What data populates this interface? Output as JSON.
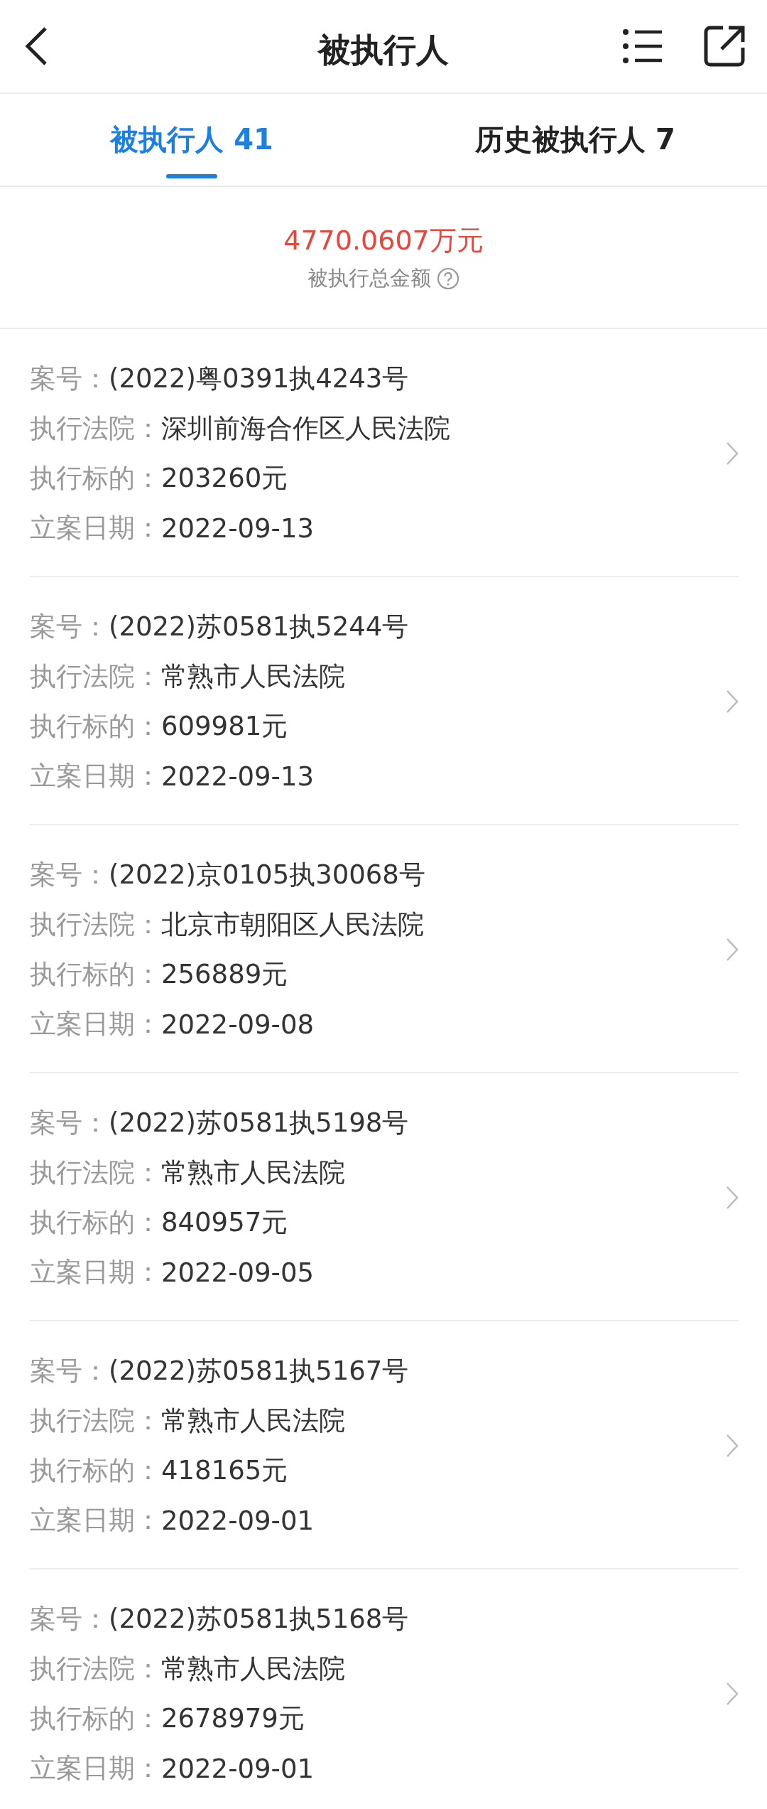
{
  "header": {
    "title": "被执行人"
  },
  "tabs": [
    {
      "label": "被执行人 41",
      "selected": true
    },
    {
      "label": "历史被执行人 7",
      "selected": false
    }
  ],
  "summary": {
    "amount": "4770.0607万元",
    "label": "被执行总金额"
  },
  "cases": [
    {
      "fields": [
        {
          "label": "案号：",
          "value": "(2022)粤0391执4243号"
        },
        {
          "label": "执行法院：",
          "value": "深圳前海合作区人民法院"
        },
        {
          "label": "执行标的：",
          "value": "203260元"
        },
        {
          "label": "立案日期：",
          "value": "2022-09-13"
        }
      ]
    },
    {
      "fields": [
        {
          "label": "案号：",
          "value": "(2022)苏0581执5244号"
        },
        {
          "label": "执行法院：",
          "value": "常熟市人民法院"
        },
        {
          "label": "执行标的：",
          "value": "609981元"
        },
        {
          "label": "立案日期：",
          "value": "2022-09-13"
        }
      ]
    },
    {
      "fields": [
        {
          "label": "案号：",
          "value": "(2022)京0105执30068号"
        },
        {
          "label": "执行法院：",
          "value": "北京市朝阳区人民法院"
        },
        {
          "label": "执行标的：",
          "value": "256889元"
        },
        {
          "label": "立案日期：",
          "value": "2022-09-08"
        }
      ]
    },
    {
      "fields": [
        {
          "label": "案号：",
          "value": "(2022)苏0581执5198号"
        },
        {
          "label": "执行法院：",
          "value": "常熟市人民法院"
        },
        {
          "label": "执行标的：",
          "value": "840957元"
        },
        {
          "label": "立案日期：",
          "value": "2022-09-05"
        }
      ]
    },
    {
      "fields": [
        {
          "label": "案号：",
          "value": "(2022)苏0581执5167号"
        },
        {
          "label": "执行法院：",
          "value": "常熟市人民法院"
        },
        {
          "label": "执行标的：",
          "value": "418165元"
        },
        {
          "label": "立案日期：",
          "value": "2022-09-01"
        }
      ]
    },
    {
      "fields": [
        {
          "label": "案号：",
          "value": "(2022)苏0581执5168号"
        },
        {
          "label": "执行法院：",
          "value": "常熟市人民法院"
        },
        {
          "label": "执行标的：",
          "value": "2678979元"
        },
        {
          "label": "立案日期：",
          "value": "2022-09-01"
        }
      ]
    }
  ]
}
